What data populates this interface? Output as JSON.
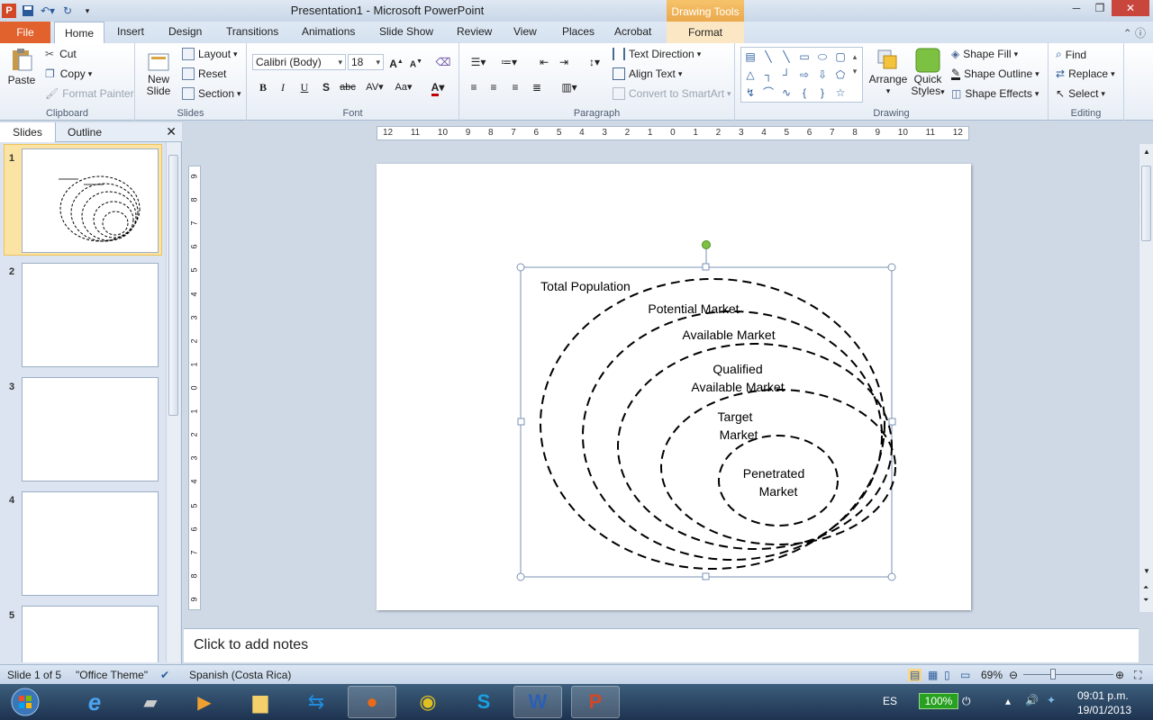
{
  "window": {
    "title": "Presentation1  -  Microsoft PowerPoint",
    "contextual_header": "Drawing Tools"
  },
  "tabs": [
    "File",
    "Home",
    "Insert",
    "Design",
    "Transitions",
    "Animations",
    "Slide Show",
    "Review",
    "View",
    "Places",
    "Acrobat",
    "Format"
  ],
  "ribbon": {
    "clipboard": {
      "label": "Clipboard",
      "paste": "Paste",
      "cut": "Cut",
      "copy": "Copy",
      "format_painter": "Format Painter"
    },
    "slides": {
      "label": "Slides",
      "new_slide_1": "New",
      "new_slide_2": "Slide",
      "layout": "Layout",
      "reset": "Reset",
      "section": "Section"
    },
    "font": {
      "label": "Font",
      "font_name": "Calibri (Body)",
      "font_size": "18"
    },
    "paragraph": {
      "label": "Paragraph",
      "text_direction": "Text Direction",
      "align_text": "Align Text",
      "convert_smartart": "Convert to SmartArt"
    },
    "drawing": {
      "label": "Drawing",
      "arrange": "Arrange",
      "quick_styles_1": "Quick",
      "quick_styles_2": "Styles",
      "shape_fill": "Shape Fill",
      "shape_outline": "Shape Outline",
      "shape_effects": "Shape Effects"
    },
    "editing": {
      "label": "Editing",
      "find": "Find",
      "replace": "Replace",
      "select": "Select"
    }
  },
  "left_pane": {
    "tab_slides": "Slides",
    "tab_outline": "Outline",
    "slides": [
      "1",
      "2",
      "3",
      "4",
      "5"
    ]
  },
  "hruler_ticks": [
    "12",
    "11",
    "10",
    "9",
    "8",
    "7",
    "6",
    "5",
    "4",
    "3",
    "2",
    "1",
    "0",
    "1",
    "2",
    "3",
    "4",
    "5",
    "6",
    "7",
    "8",
    "9",
    "10",
    "11",
    "12"
  ],
  "vruler_ticks": [
    "9",
    "8",
    "7",
    "6",
    "5",
    "4",
    "3",
    "2",
    "1",
    "0",
    "1",
    "2",
    "3",
    "4",
    "5",
    "6",
    "7",
    "8",
    "9"
  ],
  "diagram": {
    "labels": {
      "total_population": "Total Population",
      "potential_market": "Potential Market",
      "available_market": "Available  Market",
      "qualified_1": "Qualified",
      "qualified_2": "Available  Market",
      "target_1": "Target",
      "target_2": "Market",
      "penetrated_1": "Penetrated",
      "penetrated_2": "Market"
    }
  },
  "notes_placeholder": "Click to add notes",
  "status": {
    "slide_info": "Slide 1 of 5",
    "theme": "\"Office Theme\"",
    "language": "Spanish (Costa Rica)",
    "zoom": "69%"
  },
  "taskbar": {
    "lang": "ES",
    "battery": "100%",
    "time": "09:01 p.m.",
    "date": "19/01/2013"
  },
  "colors": {
    "file_tab": "#e1622d",
    "drawing_tools": "#f0b450",
    "slide_bg": "#ffffff",
    "selection": "#7a93b5",
    "rotate_handle": "#7dc142"
  }
}
